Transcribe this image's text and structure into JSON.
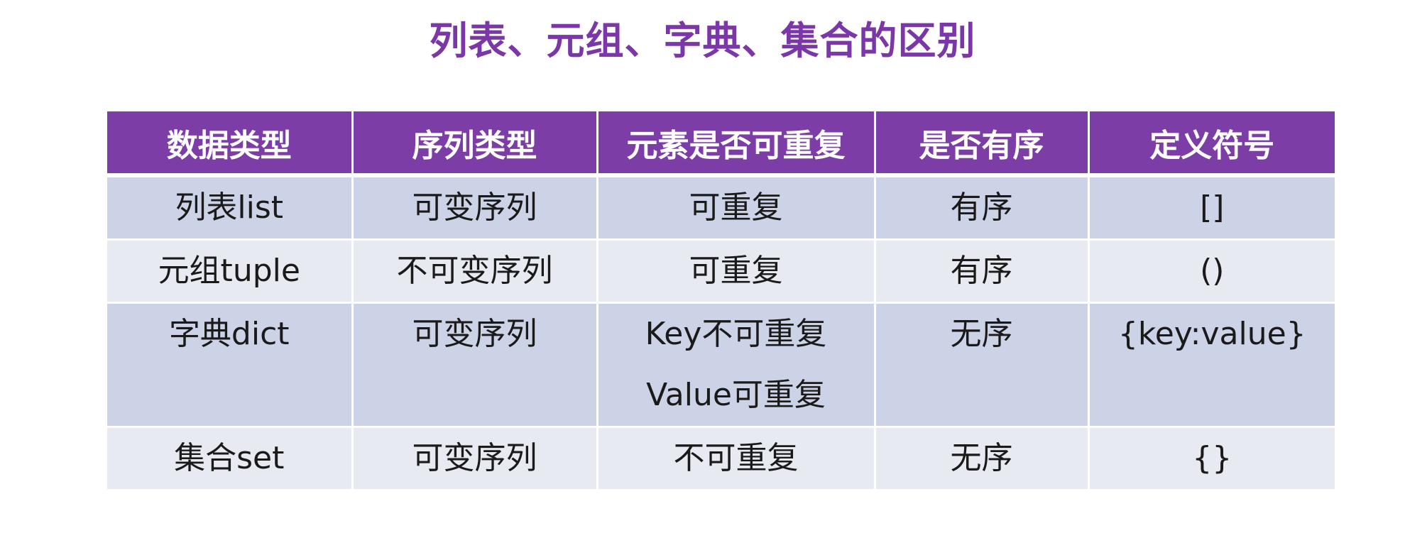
{
  "title": "列表、元组、字典、集合的区别",
  "table": {
    "headers": [
      "数据类型",
      "序列类型",
      "元素是否可重复",
      "是否有序",
      "定义符号"
    ],
    "rows": [
      {
        "type": "列表list",
        "sequence": "可变序列",
        "duplicates": [
          "可重复"
        ],
        "ordered": "有序",
        "symbol": "[]"
      },
      {
        "type": "元组tuple",
        "sequence": "不可变序列",
        "duplicates": [
          "可重复"
        ],
        "ordered": "有序",
        "symbol": "()"
      },
      {
        "type": "字典dict",
        "sequence": "可变序列",
        "duplicates": [
          "Key不可重复",
          "Value可重复"
        ],
        "ordered": "无序",
        "symbol": "{key:value}"
      },
      {
        "type": "集合set",
        "sequence": "可变序列",
        "duplicates": [
          "不可重复"
        ],
        "ordered": "无序",
        "symbol": "{}"
      }
    ]
  },
  "colors": {
    "title": "#7B36A8",
    "header_bg": "#7D3DA7",
    "row_dark": "#CDD3E6",
    "row_light": "#E8EAF2"
  }
}
